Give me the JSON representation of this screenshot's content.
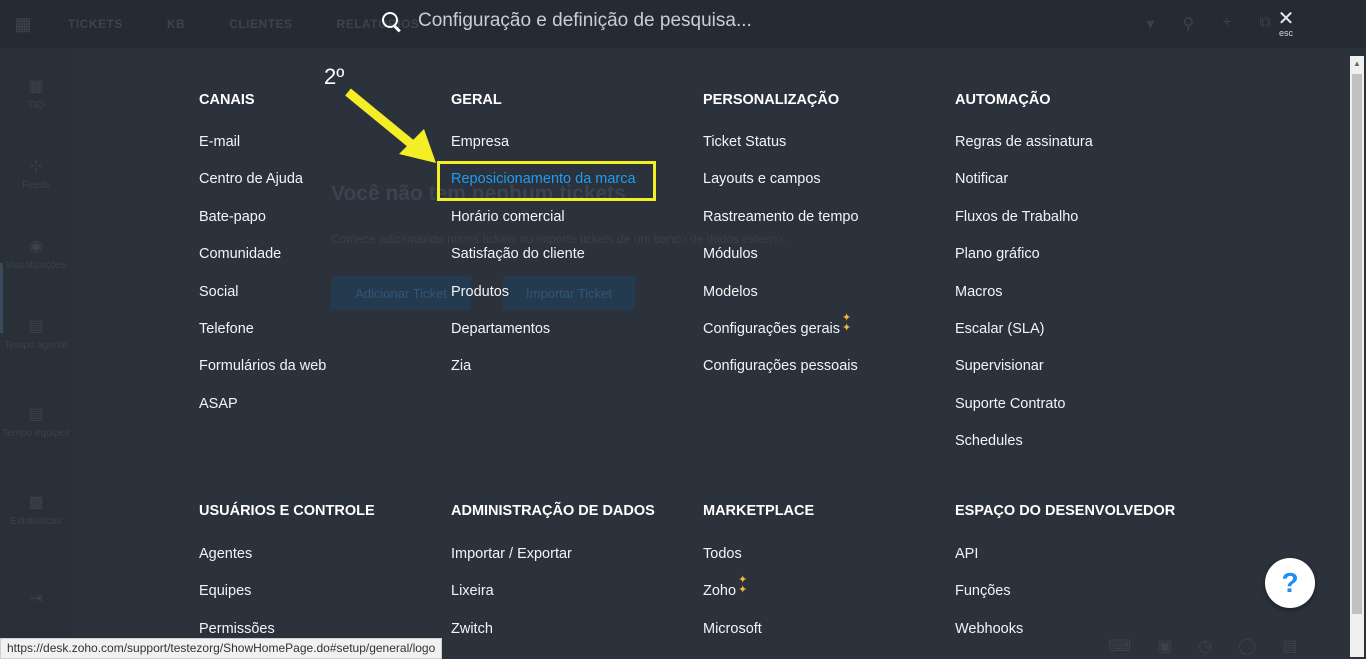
{
  "background": {
    "nav_items": [
      "TICKETS",
      "KB",
      "CLIENTES",
      "RELATÓRIOS",
      "A"
    ],
    "rail_items": [
      "TIO",
      "Feeds",
      "Visualizações",
      "Tempo agente",
      "Tempo equipes",
      "Estatísticas"
    ],
    "empty_title": "Você não tem nenhum tickets",
    "empty_sub": "Comece adicionando novos tickets ou importe tickets de um banco de dados externo.",
    "add_button": "Adicionar Ticket",
    "import_button": "Importar Ticket"
  },
  "search": {
    "placeholder": "Configuração e definição de pesquisa..."
  },
  "close": {
    "label": "esc"
  },
  "annotation": {
    "label": "2º"
  },
  "columns_top": [
    {
      "heading": "CANAIS",
      "items": [
        "E-mail",
        "Centro de Ajuda",
        "Bate-papo",
        "Comunidade",
        "Social",
        "Telefone",
        "Formulários da web",
        "ASAP"
      ]
    },
    {
      "heading": "GERAL",
      "items": [
        "Empresa",
        "Reposicionamento da marca",
        "Horário comercial",
        "Satisfação do cliente",
        "Produtos",
        "Departamentos",
        "Zia"
      ]
    },
    {
      "heading": "PERSONALIZAÇÃO",
      "items": [
        "Ticket Status",
        "Layouts e campos",
        "Rastreamento de tempo",
        "Módulos",
        "Modelos",
        "Configurações gerais",
        "Configurações pessoais"
      ]
    },
    {
      "heading": "AUTOMAÇÃO",
      "items": [
        "Regras de assinatura",
        "Notificar",
        "Fluxos de Trabalho",
        "Plano gráfico",
        "Macros",
        "Escalar (SLA)",
        "Supervisionar",
        "Suporte Contrato",
        "Schedules"
      ]
    }
  ],
  "columns_bottom": [
    {
      "heading": "USUÁRIOS E CONTROLE",
      "items": [
        "Agentes",
        "Equipes",
        "Permissões"
      ]
    },
    {
      "heading": "ADMINISTRAÇÃO DE DADOS",
      "items": [
        "Importar / Exportar",
        "Lixeira",
        "Zwitch"
      ]
    },
    {
      "heading": "MARKETPLACE",
      "items": [
        "Todos",
        "Zoho",
        "Microsoft"
      ]
    },
    {
      "heading": "ESPAÇO DO DESENVOLVEDOR",
      "items": [
        "API",
        "Funções",
        "Webhooks"
      ]
    }
  ],
  "help": {
    "label": "?"
  },
  "status_url": "https://desk.zoho.com/support/testezorg/ShowHomePage.do#setup/general/logo",
  "colors": {
    "overlay_bg": "#2c323b",
    "link_highlight": "#1f9cf0",
    "annotation_yellow": "#f3ee25",
    "sparkle": "#f4b63b"
  },
  "icons": [
    "search-icon",
    "close-icon",
    "sparkle-icon",
    "arrow-annotation-icon",
    "help-icon"
  ]
}
